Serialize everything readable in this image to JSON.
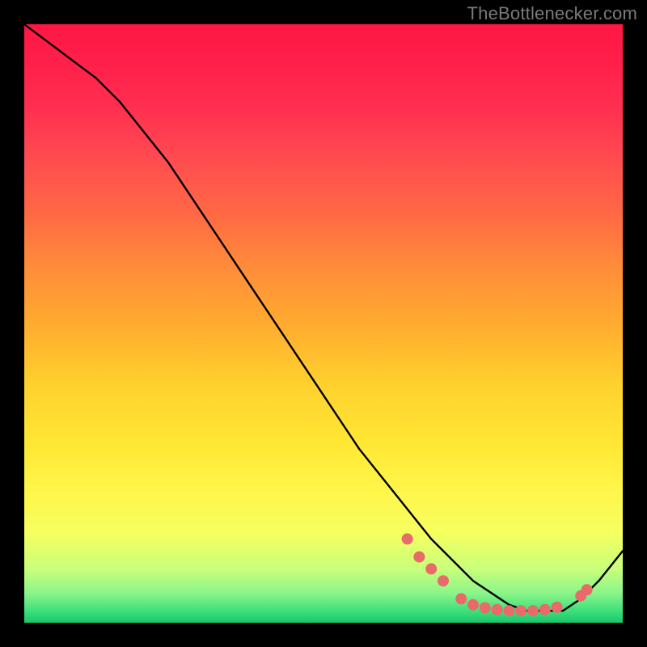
{
  "watermark": "TheBottlenecker.com",
  "colors": {
    "curve_stroke": "#000000",
    "dot_fill": "#e86a6a",
    "background": "#000000"
  },
  "chart_data": {
    "type": "line",
    "title": "",
    "xlabel": "",
    "ylabel": "",
    "xlim": [
      0,
      100
    ],
    "ylim": [
      0,
      100
    ],
    "series": [
      {
        "name": "curve",
        "x": [
          0,
          4,
          8,
          12,
          16,
          20,
          24,
          28,
          32,
          36,
          40,
          44,
          48,
          52,
          56,
          60,
          64,
          68,
          72,
          75,
          78,
          81,
          84,
          87,
          90,
          93,
          96,
          100
        ],
        "y": [
          100,
          97,
          94,
          91,
          87,
          82,
          77,
          71,
          65,
          59,
          53,
          47,
          41,
          35,
          29,
          24,
          19,
          14,
          10,
          7,
          5,
          3,
          2,
          2,
          2,
          4,
          7,
          12
        ]
      }
    ],
    "points": [
      {
        "name": "p1",
        "x": 64,
        "y": 14
      },
      {
        "name": "p2",
        "x": 66,
        "y": 11
      },
      {
        "name": "p3",
        "x": 68,
        "y": 9
      },
      {
        "name": "p4",
        "x": 70,
        "y": 7
      },
      {
        "name": "p5",
        "x": 73,
        "y": 4
      },
      {
        "name": "p6",
        "x": 75,
        "y": 3
      },
      {
        "name": "p7",
        "x": 77,
        "y": 2.5
      },
      {
        "name": "p8",
        "x": 79,
        "y": 2.2
      },
      {
        "name": "p9",
        "x": 81,
        "y": 2
      },
      {
        "name": "p10",
        "x": 83,
        "y": 2
      },
      {
        "name": "p11",
        "x": 85,
        "y": 2
      },
      {
        "name": "p12",
        "x": 87,
        "y": 2.2
      },
      {
        "name": "p13",
        "x": 89,
        "y": 2.6
      },
      {
        "name": "p14",
        "x": 93,
        "y": 4.5
      },
      {
        "name": "p15",
        "x": 94,
        "y": 5.5
      }
    ]
  }
}
